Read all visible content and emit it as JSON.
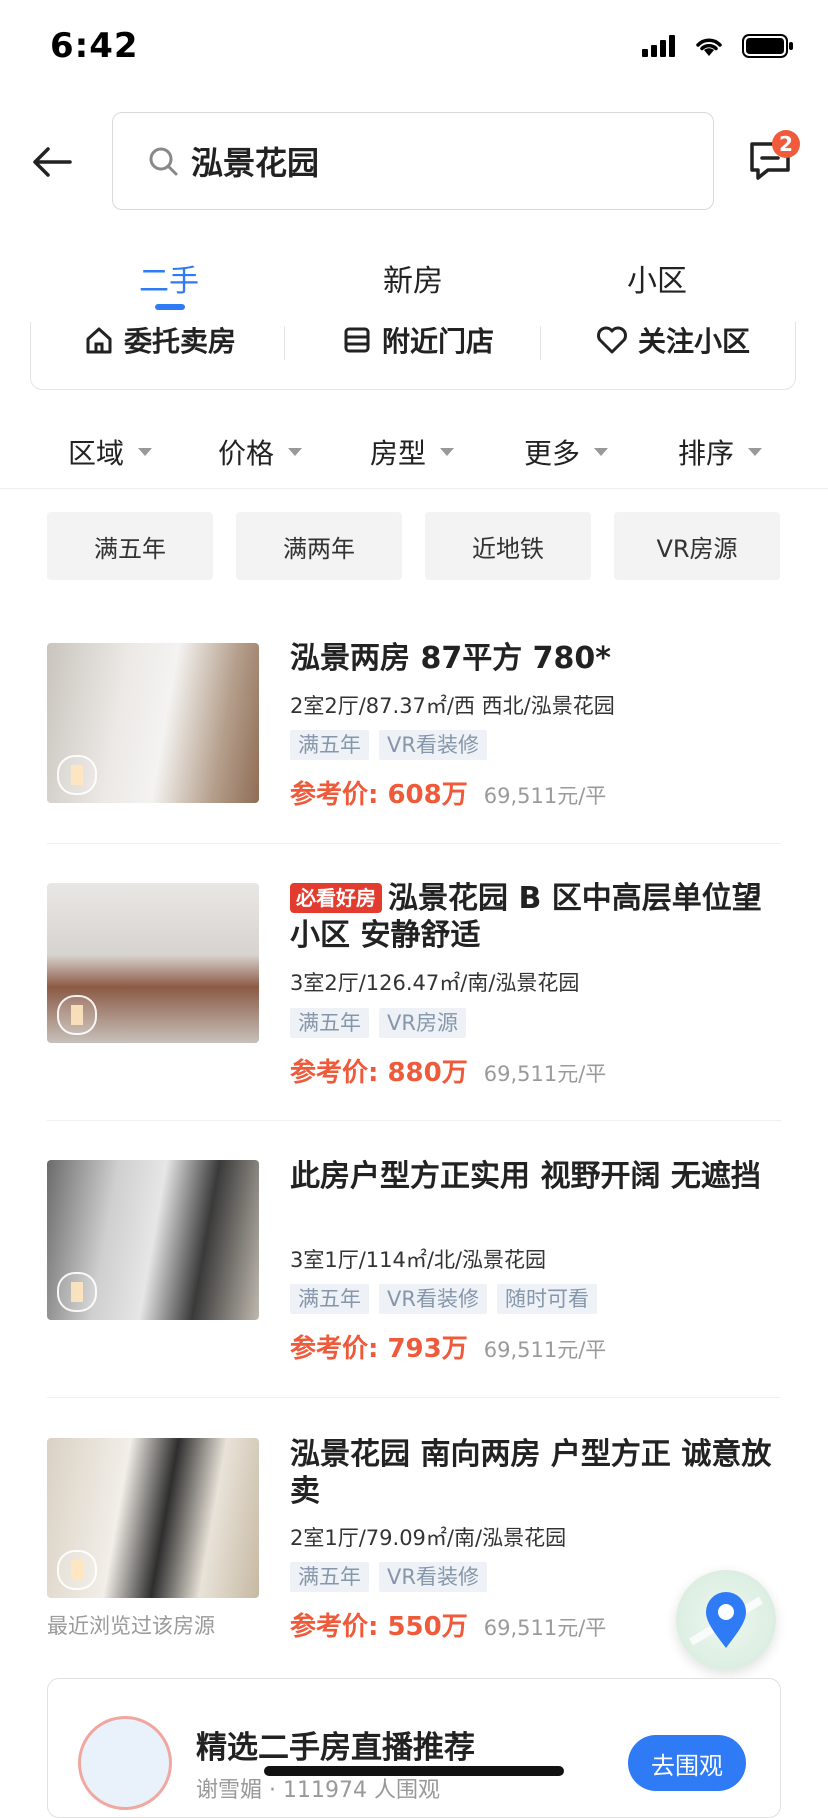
{
  "status_bar": {
    "time": "6:42"
  },
  "search": {
    "query": "泓景花园"
  },
  "messages": {
    "badge": "2"
  },
  "tabs": [
    {
      "label": "二手",
      "active": true
    },
    {
      "label": "新房",
      "active": false
    },
    {
      "label": "小区",
      "active": false
    }
  ],
  "quick_actions": [
    {
      "label": "委托卖房",
      "icon": "home-icon"
    },
    {
      "label": "附近门店",
      "icon": "store-icon"
    },
    {
      "label": "关注小区",
      "icon": "heart-icon"
    }
  ],
  "filters": [
    "区域",
    "价格",
    "房型",
    "更多",
    "排序"
  ],
  "chips": [
    "满五年",
    "满两年",
    "近地铁",
    "VR房源"
  ],
  "listings": [
    {
      "title": "泓景两房  87平方   780*",
      "badge": "",
      "spec": "2室2厅/87.37㎡/西 西北/泓景花园",
      "tags": [
        "满五年",
        "VR看装修"
      ],
      "price": "参考价: 608万",
      "unit_price": "69,511元/平"
    },
    {
      "title": "泓景花园 B 区中高层单位望小区 安静舒适",
      "badge": "必看好房",
      "spec": "3室2厅/126.47㎡/南/泓景花园",
      "tags": [
        "满五年",
        "VR房源"
      ],
      "price": "参考价: 880万",
      "unit_price": "69,511元/平"
    },
    {
      "title": "此房户型方正实用 视野开阔 无遮挡",
      "badge": "",
      "spec": "3室1厅/114㎡/北/泓景花园",
      "tags": [
        "满五年",
        "VR看装修",
        "随时可看"
      ],
      "price": "参考价: 793万",
      "unit_price": "69,511元/平"
    },
    {
      "title": "泓景花园 南向两房 户型方正 诚意放卖",
      "badge": "",
      "spec": "2室1厅/79.09㎡/南/泓景花园",
      "tags": [
        "满五年",
        "VR看装修"
      ],
      "price": "参考价: 550万",
      "unit_price": "69,511元/平"
    }
  ],
  "recent_note": "最近浏览过该房源",
  "live": {
    "title": "精选二手房直播推荐",
    "subtitle": "谢雪媚 · 111974 人围观",
    "button": "去围观"
  },
  "colors": {
    "accent": "#2f7bf6",
    "price": "#ee5a3a",
    "badge": "#e33b2e"
  }
}
